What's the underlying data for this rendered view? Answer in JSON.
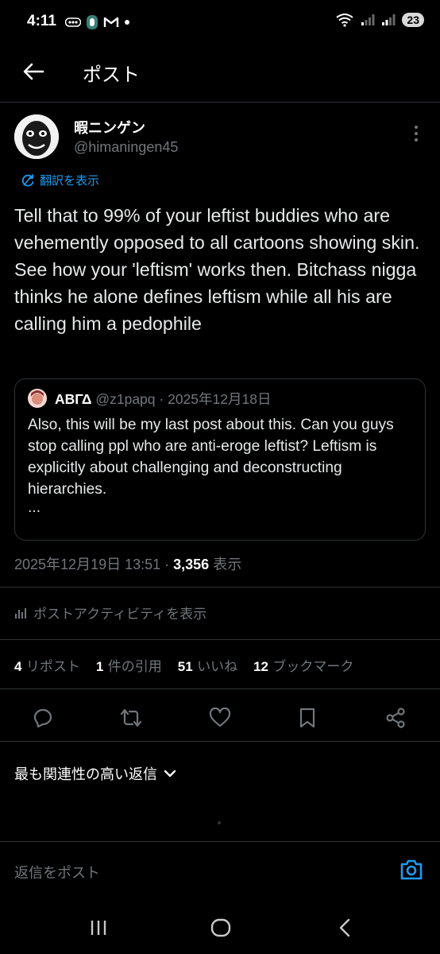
{
  "status_bar": {
    "time": "4:11",
    "battery": "23",
    "icons": [
      "ooo-icon",
      "shield-app-icon",
      "gmail-icon",
      "dot-icon",
      "wifi-icon",
      "signal-icon",
      "signal-icon"
    ]
  },
  "header": {
    "title": "ポスト"
  },
  "author": {
    "name": "暇ニンゲン",
    "handle": "@himaningen45"
  },
  "translate_label": "翻訳を表示",
  "post_text": "Tell that to 99% of your leftist buddies who are vehemently opposed to all cartoons showing skin. See how your 'leftism' works then. Bitchass nigga thinks he alone defines leftism while all his are calling him a pedophile",
  "quote": {
    "name": "ΑΒΓΔ",
    "handle": "@z1papq",
    "separator": " · ",
    "date": "2025年12月18日",
    "text": "Also, this will be my last post about this. Can you guys stop calling ppl who are anti-eroge leftist? Leftism is explicitly about challenging and deconstructing hierarchies.",
    "ellipsis": "..."
  },
  "timestamp": {
    "datetime": "2025年12月19日 13:51",
    "separator": " · ",
    "views": "3,356",
    "views_label": " 表示"
  },
  "activity_label": "ポストアクティビティを表示",
  "stats": [
    {
      "count": "4",
      "label": "リポスト"
    },
    {
      "count": "1",
      "label": "件の引用"
    },
    {
      "count": "51",
      "label": "いいね"
    },
    {
      "count": "12",
      "label": "ブックマーク"
    }
  ],
  "sort_label": "最も関連性の高い返信",
  "reply_placeholder": "返信をポスト",
  "colors": {
    "background": "#000000",
    "text": "#e7e9ea",
    "muted": "#71767b",
    "accent": "#1d9bf0",
    "divider": "#2f3336"
  }
}
